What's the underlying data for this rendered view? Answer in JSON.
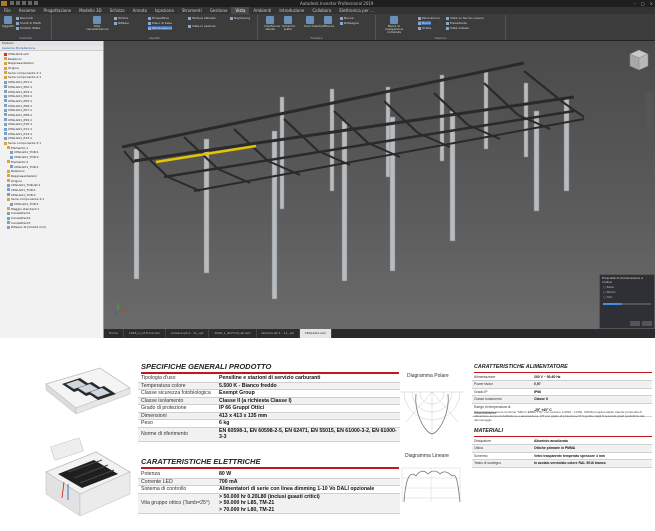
{
  "app": {
    "title": "Autodesk Inventor Professional 2019",
    "ribbon_tabs": [
      "File",
      "Assieme",
      "Progettazione",
      "Modello 3D",
      "Schizzo",
      "Annota",
      "Ispeziona",
      "Strumenti",
      "Gestione",
      "Vista",
      "Ambienti",
      "Introduzione",
      "Collabora",
      "Elettronica per ..."
    ],
    "active_tab_index": 9,
    "ribbon": {
      "groups": [
        {
          "label": "Visibilità",
          "buttons": [
            "Oggetto",
            "Raccordi",
            "Snodi di filetti",
            "Simboli iMate"
          ]
        },
        {
          "label": "Aspetto",
          "buttons": [
            "Stile visualizzazione",
            "Ombre",
            "Riflessi",
            "Prospettiva",
            "Piano di base",
            "Illuminazione",
            "Texture attivate",
            "Raytracing",
            "Vista in sezione"
          ]
        },
        {
          "label": "Finestra",
          "buttons": [
            "Interfaccia utente",
            "Schermo pulito",
            "Scorrimento",
            "Affianca",
            "Affianca in modo",
            "Nuova",
            "Ridisegna"
          ]
        },
        {
          "label": "Esplora",
          "buttons": [
            "Barra di navigazione completa",
            "Panoramica",
            "Zoom",
            "Orbita",
            "Vista su faccia o piano",
            "Precedente",
            "Vista iniziale"
          ]
        }
      ]
    },
    "browser": {
      "header": "Modello",
      "tabs": "Assieme   Modellazione",
      "nodes": [
        "CPGLGO1.iam",
        "Relazioni",
        "Rappresentazioni",
        "Origine",
        "Serie componente 1:1",
        "Serie componente 2:1",
        "CPGLG01_P01:1",
        "CPGLG01_P02:1",
        "CPGLG01_P03:1",
        "CPGLG01_P04:1",
        "CPGLG01_P05:1",
        "CPGLG01_P06:1",
        "CPGLG01_P07:1",
        "CPGLG01_P08:1",
        "CPGLG01_P09:1",
        "CPGLG01_P10:1",
        "CPGLG01_P11:1",
        "CPGLG01_P12:1",
        "CPGLG01_P13:1",
        "Serie componente 3:1",
        "Elemento:1",
        "CPGLG01_TOR:1",
        "CPGLG01_TOR:2",
        "Elemento:2",
        "CPGLG01_TOR:1",
        "Relazioni",
        "Rappresentazioni",
        "Origine",
        "CPGLG01_TOR.iat:1",
        "CPGLG01_TOR:1",
        "CPGLG01_TOR:2",
        "Serie componente 4:1",
        "CPGLG01_TOR:1",
        "Maggio standard:1",
        "Canalette:01",
        "Canalette:02",
        "Canalette:03",
        "Riflesso 0l (CGSL4 mm)"
      ]
    },
    "document_tabs": [
      "Home",
      "1026_1_ist.Front.iam",
      "lamiera.ipt.2 - 11_.ipt",
      "1026_1_ist.Front_sb.iam",
      "lamiera.ipt.1 - 11_.ipt",
      "CPGLGO1.iam"
    ],
    "active_doc_tab": 5,
    "panel": {
      "title": "Proprietà di illuminazione e ombre",
      "options": [
        "Base",
        "Medio",
        "Alto"
      ]
    }
  },
  "sheet": {
    "general": {
      "title": "SPECIFICHE GENERALI PRODOTTO",
      "rows": [
        {
          "k": "Tipologia d'uso",
          "v": "Pensiline e stazioni di servizio carburanti"
        },
        {
          "k": "Temperatura colore",
          "v": "5.500 K - Bianco freddo"
        },
        {
          "k": "Classe sicurezza fotobiologica",
          "v": "Exempt Group"
        },
        {
          "k": "Classe isolamento",
          "v": "Classe II  (a richiesta Classe I)"
        },
        {
          "k": "Grado di protezione",
          "v": "IP 66 Gruppi Ottici"
        },
        {
          "k": "Dimensioni",
          "v": "413 x 413 x 135 mm"
        },
        {
          "k": "Peso",
          "v": "6 kg"
        },
        {
          "k": "Norme di riferimento",
          "v": "EN 60598-1, EN 60598-2-5, EN 62471, EN 55015, EN 61000-3-2, EN 61000-3-3"
        }
      ]
    },
    "electrical": {
      "title": "CARATTERISTICHE ELETTRICHE",
      "rows": [
        {
          "k": "Potenza",
          "v": "80 W"
        },
        {
          "k": "Corrente LED",
          "v": "700 mA"
        },
        {
          "k": "Sistema di controllo",
          "v": "Alimentatori di serie con linea dimming 1-10 Vo DALI opzionale"
        },
        {
          "k": "Vita gruppo ottico (Tamb=25°)",
          "v": "> 50.000 hr 0.20L80 (inclusi guasti critici)\n> 50.000 hr L85, TM-21\n> 70.000 hr L80, TM-21"
        }
      ]
    },
    "diagrams": {
      "polar": "Diagramma Polare",
      "linear": "Diagramma Lineare"
    },
    "power_supply": {
      "title": "CARATTERISTICHE ALIMENTATORE",
      "rows": [
        {
          "k": "Alimentazione",
          "v": "200 V ~ 50-60 Hz"
        },
        {
          "k": "Power factor",
          "v": "0,97"
        },
        {
          "k": "Grado IP",
          "v": "IP66"
        },
        {
          "k": "Classe isolamento",
          "v": "Classe II"
        },
        {
          "k": "Range di temperatura di funzionamento",
          "v": "-25° +40° C"
        }
      ],
      "note": "Alimentazione avente funzione \"MFLO-ERBUTTO\" con sezione a 9910 - 1CHE, 10538 programmabile tramite protocolla di attivazione-tempo di definizione o automazione. DT con grado di protezione IP 6 gestito dagli 8 secondo gradi predefinito del dimmeraggio."
    },
    "materials": {
      "title": "MATERIALI",
      "rows": [
        {
          "k": "Dissipatore",
          "v": "Alluminio anodizzato"
        },
        {
          "k": "Ottica",
          "v": "Ottiche primarie in PMMA"
        },
        {
          "k": "Schermo",
          "v": "Vetro trasparente temperato spessore 4 mm"
        },
        {
          "k": "Telaio di sostegno",
          "v": "In acciaio verniciato colore RAL 9016 bianco"
        }
      ]
    }
  }
}
